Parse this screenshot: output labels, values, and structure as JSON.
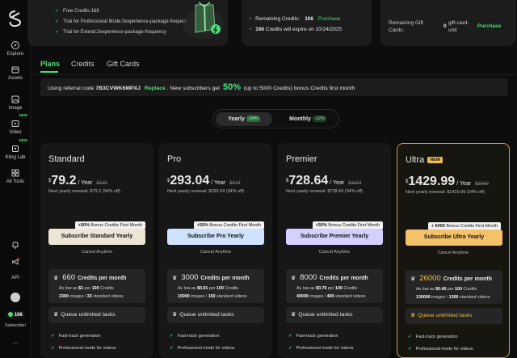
{
  "sidebar": {
    "items": [
      {
        "label": "Explore",
        "icon": "compass-icon"
      },
      {
        "label": "Assets",
        "icon": "folder-icon"
      },
      {
        "label": "Image",
        "icon": "image-icon"
      },
      {
        "label": "Video",
        "icon": "video-icon",
        "badge": "NEW"
      },
      {
        "label": "Kling Lab",
        "icon": "lab-icon",
        "badge": "NEW"
      },
      {
        "label": "All Tools",
        "icon": "grid-icon"
      }
    ],
    "bottom": {
      "api_label": "API",
      "credits": "166",
      "subscribe_label": "Subscribe!",
      "more": "..."
    }
  },
  "top": {
    "trial_lines": [
      "Free Credits:166",
      "Trial for Professional Mode:3experience-package-frequen",
      "Trial for Extend:2experience-package-frequency"
    ],
    "remaining": {
      "label": "Remaining Credits:",
      "value": "166",
      "purchase": "Purchase",
      "expire_count": "166",
      "expire_text": "Credits will expire on 10/24/2025"
    },
    "gift": {
      "label_1": "Remaining Gift",
      "label_2": "Cards:",
      "value": "0",
      "unit_1": "gift-card-",
      "unit_2": "unit",
      "purchase": "Purchase"
    }
  },
  "tabs": [
    "Plans",
    "Credits",
    "Gift Cards"
  ],
  "referral": {
    "prefix": "Using referral code",
    "code": "7B3CVWK6MPXJ",
    "replace": "Replace",
    "middle": ". New subscribers get",
    "percent": "50%",
    "suffix": "(up to 5000 Credits) bonus Credits first month"
  },
  "billing_toggle": {
    "yearly": "Yearly",
    "yearly_discount": "-34%",
    "monthly": "Monthly",
    "monthly_discount": "-12%"
  },
  "common": {
    "year": "/ Year",
    "cancel": "Cancel Anytime",
    "credits_per_month": "Credits per month",
    "queue": "Queue unlimited tasks",
    "feature_1": "Fast-track generation",
    "feature_2": "Professional mode for videos",
    "as_low_as": "As low as",
    "per": "per",
    "credits_word": "Credits",
    "images": "images",
    "standard_videos": "standard videos",
    "currency": "$"
  },
  "plans": [
    {
      "name": "Standard",
      "price": "79.2",
      "strike": "$120",
      "renewal": "Next yearly renewal: $79.2 (34% off)",
      "bonus_bold": "+50%",
      "bonus_text": "Bonus Credits First Month",
      "subscribe": "Subscribe Standard Yearly",
      "credits": "660",
      "per_price": "$1",
      "per_unit": "100",
      "images": "3300",
      "videos": "33"
    },
    {
      "name": "Pro",
      "price": "293.04",
      "strike": "$444",
      "renewal": "Next yearly renewal: $293.04 (34% off)",
      "bonus_bold": "+50%",
      "bonus_text": "Bonus Credits First Month",
      "subscribe": "Subscribe Pro Yearly",
      "credits": "3000",
      "per_price": "$0.81",
      "per_unit": "100",
      "images": "15000",
      "videos": "150"
    },
    {
      "name": "Premier",
      "price": "728.64",
      "strike": "$1104",
      "renewal": "Next yearly renewal: $728.64 (34% off)",
      "bonus_bold": "+50%",
      "bonus_text": "Bonus Credits First Month",
      "subscribe": "Subscribe Premier Yearly",
      "credits": "8000",
      "per_price": "$0.76",
      "per_unit": "100",
      "images": "40000",
      "videos": "400"
    },
    {
      "name": "Ultra",
      "badge": "NEW",
      "price": "1429.99",
      "strike": "$2160",
      "renewal": "Next yearly renewal: $1429.99 (34% off)",
      "bonus_bold": "+ 5000",
      "bonus_text": "Bonus Credits First Month",
      "subscribe": "Subscribe Ultra Yearly",
      "credits": "26000",
      "per_price": "$0.46",
      "per_unit": "100",
      "images": "130000",
      "videos": "1300"
    }
  ],
  "colors": {
    "accent": "#46e07a",
    "gold": "#f0c040",
    "standard_btn": "#ece6d6",
    "pro_btn": "#cfe3ff",
    "premier_btn": "#d4d0ff",
    "ultra_btn": "#f5c26a"
  }
}
